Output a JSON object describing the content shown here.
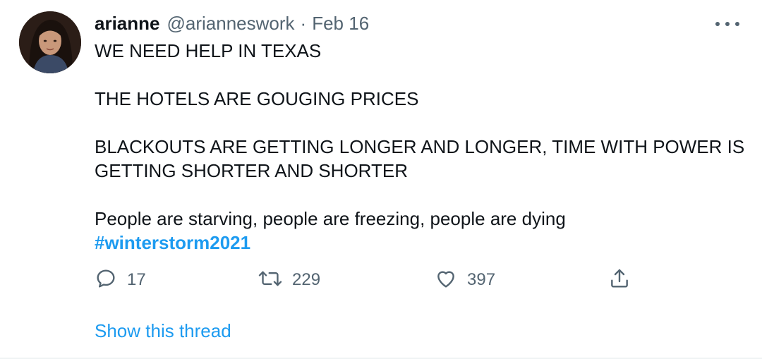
{
  "user": {
    "name": "arianne",
    "handle": "@arianneswork",
    "separator": "·",
    "date": "Feb 16"
  },
  "tweet": {
    "lines": [
      "WE NEED HELP IN TEXAS",
      "THE HOTELS ARE GOUGING PRICES",
      "BLACKOUTS ARE GETTING LONGER AND LONGER, TIME WITH POWER IS GETTING SHORTER AND SHORTER",
      "People are starving, people are freezing, people are dying"
    ],
    "hashtag": "#winterstorm2021"
  },
  "actions": {
    "replies": "17",
    "retweets": "229",
    "likes": "397"
  },
  "icons": {
    "reply": "reply-icon",
    "retweet": "retweet-icon",
    "like": "heart-icon",
    "share": "share-icon",
    "more": "more-options-icon"
  },
  "show_thread": "Show this thread",
  "colors": {
    "link": "#1d9bf0",
    "secondary_text": "#536471",
    "primary_text": "#0f1419"
  }
}
